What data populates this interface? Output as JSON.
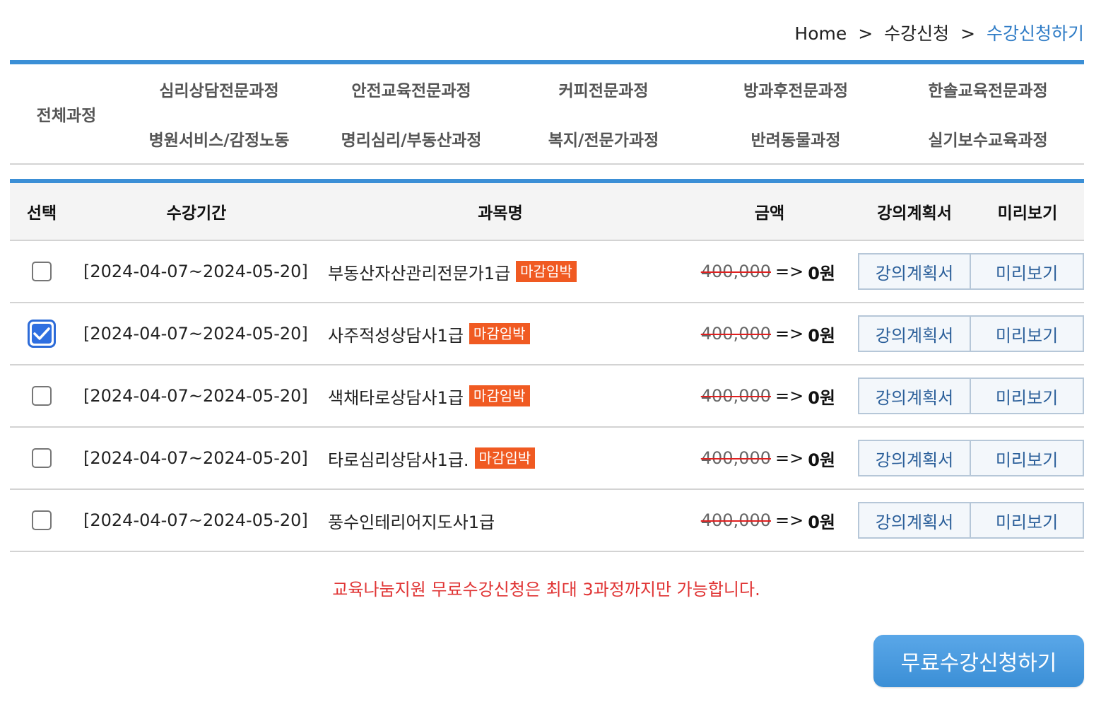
{
  "breadcrumb": {
    "home": "Home",
    "sep1": ">",
    "level1": "수강신청",
    "sep2": ">",
    "current": "수강신청하기"
  },
  "categories": {
    "all": "전체과정",
    "items": [
      "심리상담전문과정",
      "안전교육전문과정",
      "커피전문과정",
      "방과후전문과정",
      "한솔교육전문과정",
      "병원서비스/감정노동",
      "명리심리/부동산과정",
      "복지/전문가과정",
      "반려동물과정",
      "실기보수교육과정"
    ]
  },
  "table": {
    "headers": {
      "select": "선택",
      "period": "수강기간",
      "name": "과목명",
      "price": "금액",
      "plan": "강의계획서",
      "preview": "미리보기"
    },
    "rows": [
      {
        "checked": false,
        "period": "[2024-04-07~2024-05-20]",
        "name": "부동산자산관리전문가1급",
        "badge": "마감임박",
        "old_price": "400,000",
        "arrow": "=>",
        "new_price": "0원",
        "plan_label": "강의계획서",
        "preview_label": "미리보기"
      },
      {
        "checked": true,
        "period": "[2024-04-07~2024-05-20]",
        "name": "사주적성상담사1급",
        "badge": "마감임박",
        "old_price": "400,000",
        "arrow": "=>",
        "new_price": "0원",
        "plan_label": "강의계획서",
        "preview_label": "미리보기"
      },
      {
        "checked": false,
        "period": "[2024-04-07~2024-05-20]",
        "name": "색채타로상담사1급",
        "badge": "마감임박",
        "old_price": "400,000",
        "arrow": "=>",
        "new_price": "0원",
        "plan_label": "강의계획서",
        "preview_label": "미리보기"
      },
      {
        "checked": false,
        "period": "[2024-04-07~2024-05-20]",
        "name": "타로심리상담사1급.",
        "badge": "마감임박",
        "old_price": "400,000",
        "arrow": "=>",
        "new_price": "0원",
        "plan_label": "강의계획서",
        "preview_label": "미리보기"
      },
      {
        "checked": false,
        "period": "[2024-04-07~2024-05-20]",
        "name": "풍수인테리어지도사1급",
        "badge": "",
        "old_price": "400,000",
        "arrow": "=>",
        "new_price": "0원",
        "plan_label": "강의계획서",
        "preview_label": "미리보기"
      }
    ]
  },
  "notice": "교육나눔지원 무료수강신청은 최대 3과정까지만 가능합니다.",
  "apply_button": "무료수강신청하기",
  "colors": {
    "accent": "#3b8fd6",
    "badge": "#f05a22",
    "notice": "#e03434",
    "link": "#2f7cc6"
  }
}
